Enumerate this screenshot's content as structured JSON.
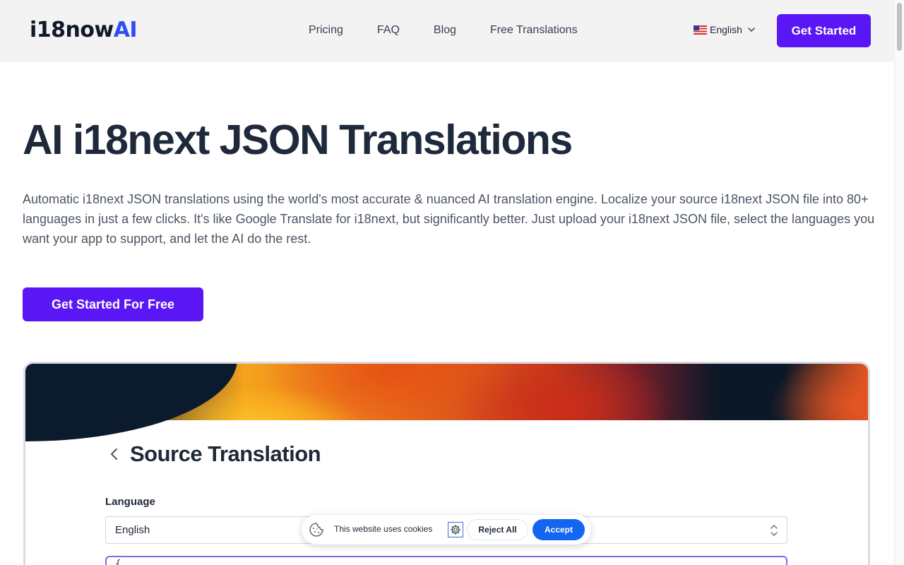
{
  "header": {
    "logo": {
      "part1": "i18",
      "part2": "now",
      "part3": "AI"
    },
    "nav": [
      {
        "label": "Pricing"
      },
      {
        "label": "FAQ"
      },
      {
        "label": "Blog"
      },
      {
        "label": "Free Translations"
      }
    ],
    "language": {
      "flag": "us-flag-icon",
      "label": "English"
    },
    "cta_label": "Get Started"
  },
  "hero": {
    "title": "AI i18next JSON Translations",
    "description": "Automatic i18next JSON translations using the world's most accurate & nuanced AI translation engine. Localize your source i18next JSON file into 80+ languages in just a few clicks. It's like Google Translate for i18next, but significantly better. Just upload your i18next JSON file, select the languages you want your app to support, and let the AI do the rest.",
    "cta_label": "Get Started For Free"
  },
  "preview": {
    "title": "Source Translation",
    "language_label": "Language",
    "language_value": "English",
    "editor_start": "{"
  },
  "cookie": {
    "text": "This website uses cookies",
    "reject_label": "Reject All",
    "accept_label": "Accept"
  },
  "colors": {
    "primary": "#5b16f5",
    "logo_blue": "#2f4df5",
    "accept_blue": "#1366f0",
    "heading": "#1e293b"
  }
}
